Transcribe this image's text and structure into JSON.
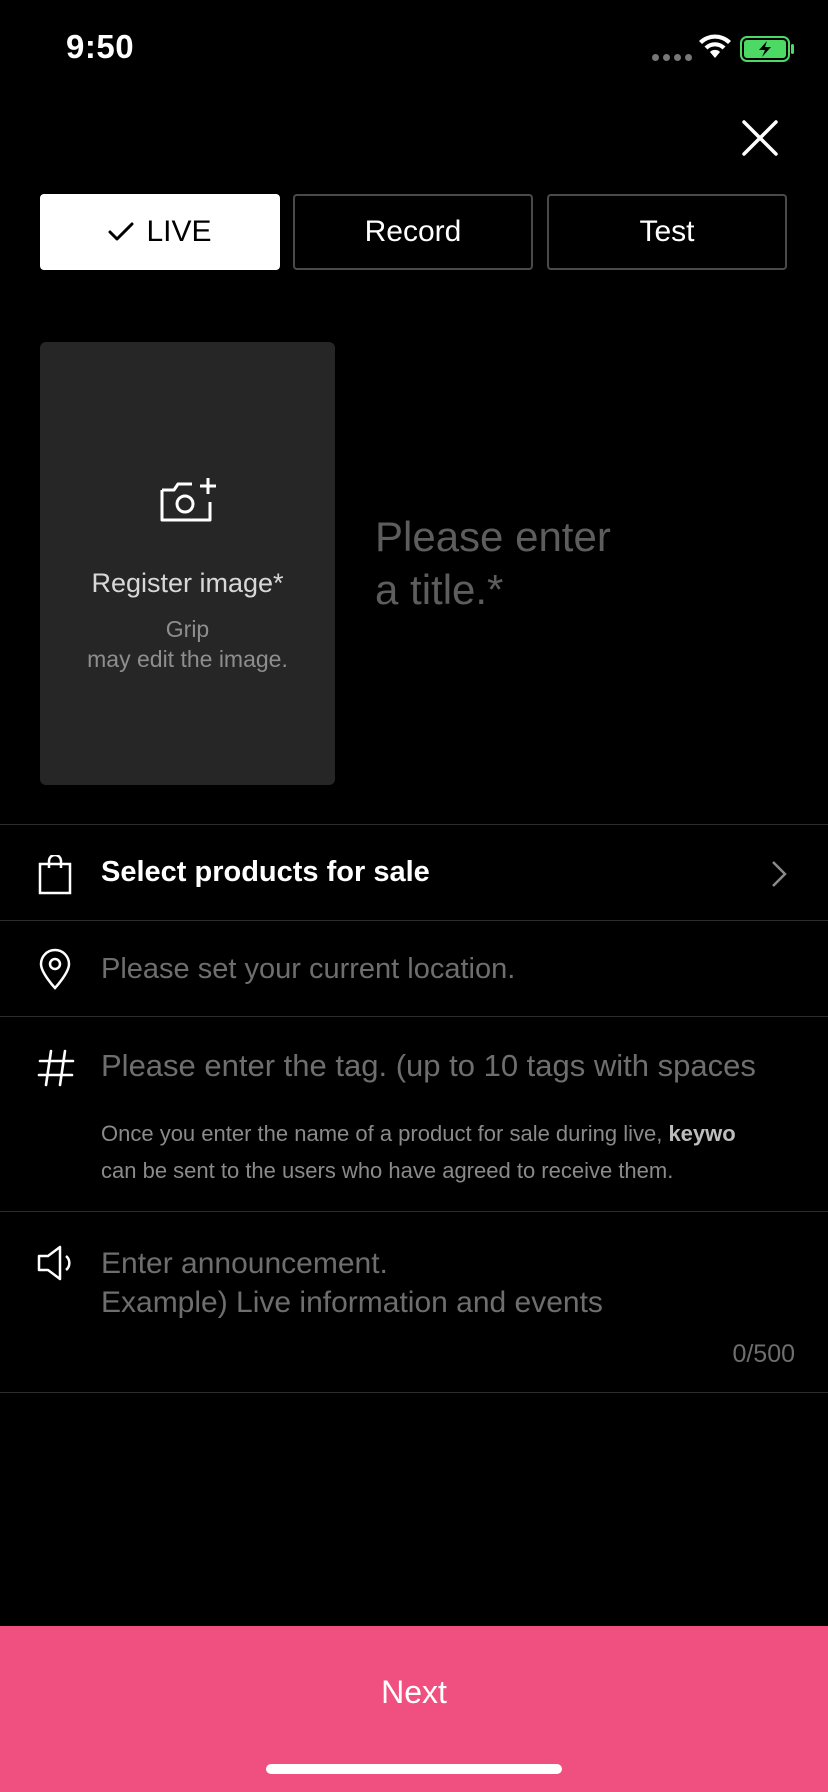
{
  "status_bar": {
    "time": "9:50"
  },
  "mode_tabs": {
    "live": "LIVE",
    "record": "Record",
    "test": "Test",
    "selected": "LIVE"
  },
  "image_card": {
    "label": "Register image*",
    "note": "Grip\nmay edit the image."
  },
  "title_placeholder": "Please enter\na title.*",
  "products": {
    "label": "Select products for sale"
  },
  "location": {
    "placeholder": "Please set your current location."
  },
  "tags": {
    "placeholder": "Please enter the tag. (up to 10 tags with spaces",
    "note_prefix": "Once you enter the name of a product for sale during live, ",
    "note_bold": "keywo",
    "note_line2": "can be sent to the users who have agreed to receive them."
  },
  "announcement": {
    "placeholder": "Enter announcement.\nExample) Live information and events",
    "char_count": "0/500"
  },
  "next_button": {
    "label": "Next"
  },
  "colors": {
    "accent": "#ef5080",
    "background": "#000000",
    "card": "#262626",
    "battery": "#4cd964"
  }
}
